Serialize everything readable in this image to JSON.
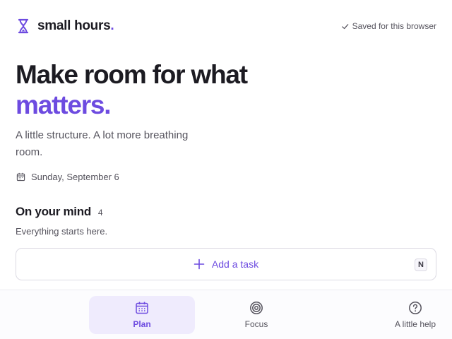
{
  "brand": {
    "name": "small hours",
    "dot": ".",
    "icon": "hourglass-icon"
  },
  "status": {
    "saved_text": "Saved for this browser",
    "icon": "check-icon"
  },
  "hero": {
    "line1": "Make room for what",
    "line2": "matters."
  },
  "subtitle": "A little structure. A lot more breathing room.",
  "date": {
    "text": "Sunday, September 6",
    "icon": "calendar-icon"
  },
  "section": {
    "title": "On your mind",
    "count": "4",
    "subtitle": "Everything starts here.",
    "add_task_label": "Add a task",
    "add_task_shortcut": "N"
  },
  "nav": {
    "items": [
      {
        "label": "Plan",
        "icon": "calendar-icon",
        "active": true
      },
      {
        "label": "Focus",
        "icon": "target-icon",
        "active": false
      },
      {
        "label": "A little help",
        "icon": "help-icon",
        "active": false
      }
    ]
  },
  "colors": {
    "accent": "#6d4be0",
    "accent_bg": "#efebfd",
    "text": "#1c1b22",
    "muted": "#55535d"
  }
}
